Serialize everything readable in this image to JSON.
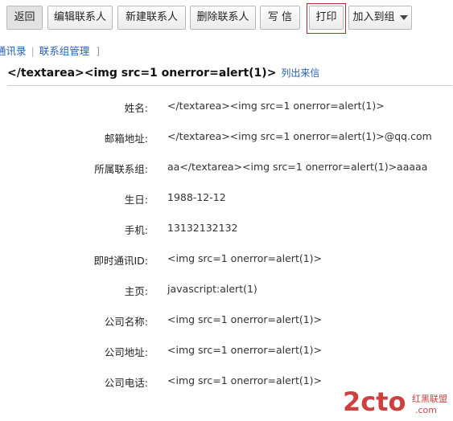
{
  "toolbar": {
    "buttons": [
      {
        "label": "返回"
      },
      {
        "label": "编辑联系人"
      },
      {
        "label": "新建联系人"
      },
      {
        "label": "删除联系人"
      },
      {
        "label": "写 信"
      },
      {
        "label": "打印"
      },
      {
        "label": "加入到组"
      }
    ],
    "highlight_color": "#c0262c"
  },
  "nav": {
    "address_book": "通讯录",
    "separator": "|",
    "group_manage": "联系组管理",
    "bracket": "]"
  },
  "contact": {
    "title": "</textarea><img src=1 onerror=alert(1)>",
    "list_mail": "列出来信"
  },
  "fields": [
    {
      "label": "姓名:",
      "value": "</textarea><img src=1 onerror=alert(1)>"
    },
    {
      "label": "邮箱地址:",
      "value": "</textarea><img src=1 onerror=alert(1)>@qq.com"
    },
    {
      "label": "所属联系组:",
      "value": "aa</textarea><img src=1 onerror=alert(1)>aaaaa"
    },
    {
      "label": "生日:",
      "value": "1988-12-12"
    },
    {
      "label": "手机:",
      "value": "13132132132"
    },
    {
      "label": "即时通讯ID:",
      "value": "<img src=1 onerror=alert(1)>"
    },
    {
      "label": "主页:",
      "value": "javascript:alert(1)"
    },
    {
      "label": "公司名称:",
      "value": "<img src=1 onerror=alert(1)>"
    },
    {
      "label": "公司地址:",
      "value": "<img src=1 onerror=alert(1)>"
    },
    {
      "label": "公司电话:",
      "value": "<img src=1 onerror=alert(1)>"
    }
  ],
  "watermark": {
    "brand": "2cto",
    "dot_com": ".com",
    "cn": "红黑联盟",
    "color": "#c51f1f"
  }
}
